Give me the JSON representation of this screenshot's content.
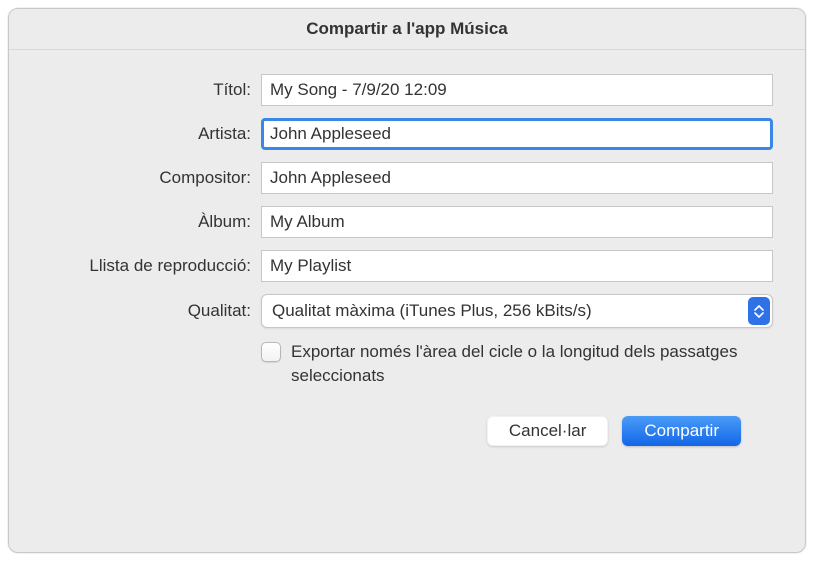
{
  "dialog": {
    "title": "Compartir a l'app Música"
  },
  "form": {
    "title": {
      "label": "Títol:",
      "value": "My Song - 7/9/20 12:09"
    },
    "artist": {
      "label": "Artista:",
      "value": "John Appleseed"
    },
    "composer": {
      "label": "Compositor:",
      "value": "John Appleseed"
    },
    "album": {
      "label": "Àlbum:",
      "value": "My Album"
    },
    "playlist": {
      "label": "Llista de reproducció:",
      "value": "My Playlist"
    },
    "quality": {
      "label": "Qualitat:",
      "value": "Qualitat màxima (iTunes Plus, 256 kBits/s)"
    },
    "export_only": {
      "label": "Exportar només l'àrea del cicle o la longitud dels passatges seleccionats",
      "checked": false
    }
  },
  "buttons": {
    "cancel": "Cancel·lar",
    "share": "Compartir"
  }
}
